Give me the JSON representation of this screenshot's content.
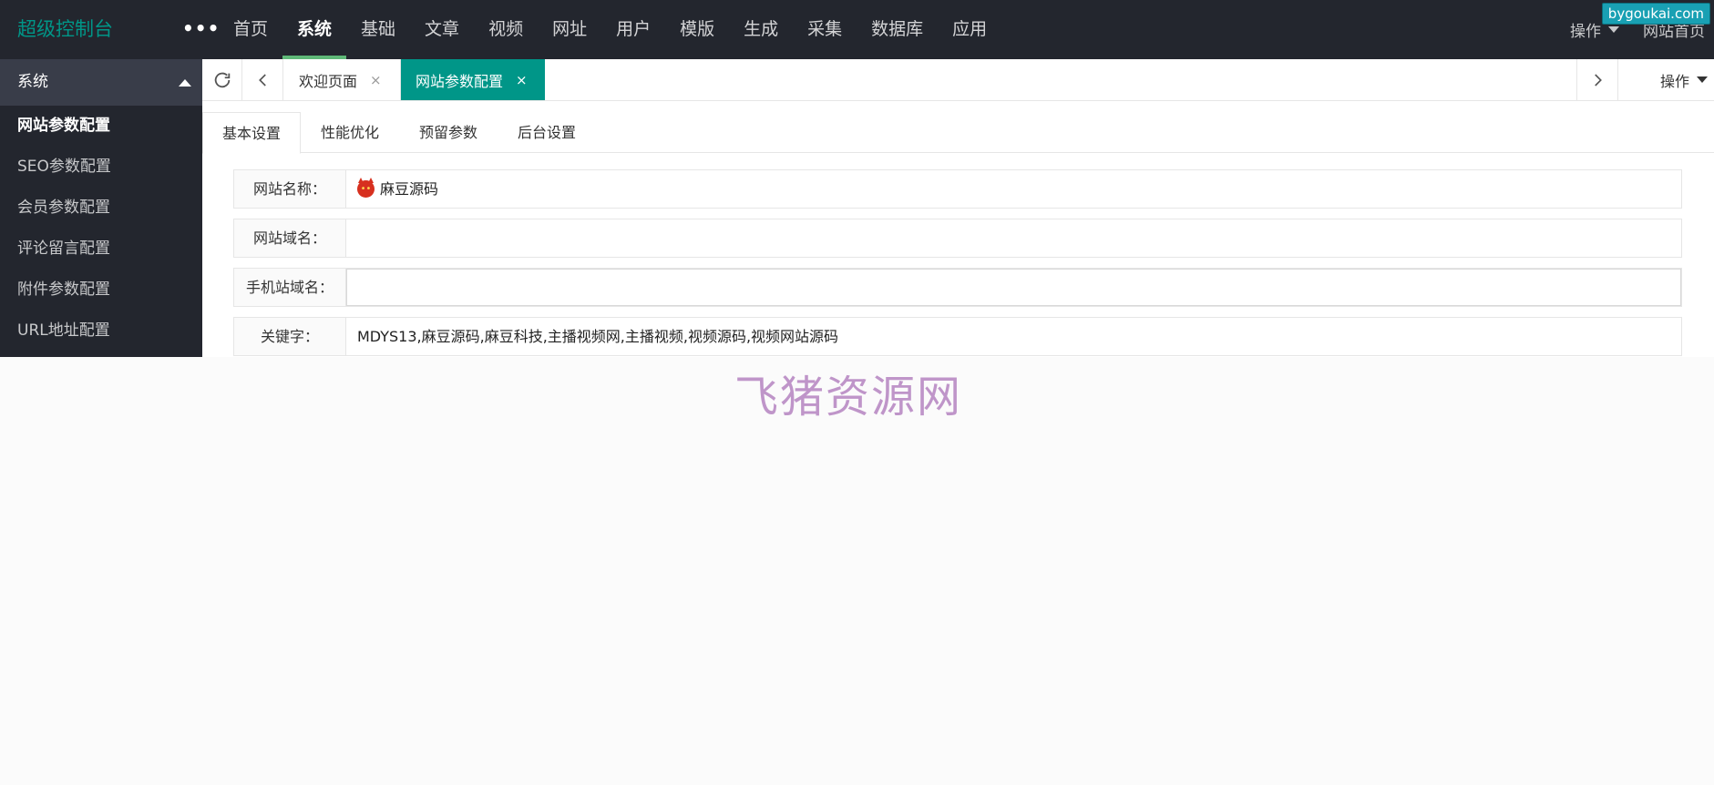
{
  "header": {
    "logo": "超级控制台",
    "more": "•••",
    "nav": [
      "首页",
      "系统",
      "基础",
      "文章",
      "视频",
      "网址",
      "用户",
      "模版",
      "生成",
      "采集",
      "数据库",
      "应用"
    ],
    "ops_label": "操作",
    "site_home": "网站首页",
    "badge": "bygoukai.com",
    "accent": "#009688",
    "active_underline": "#5fb878"
  },
  "sidebar": {
    "section": "系统",
    "items": [
      "网站参数配置",
      "SEO参数配置",
      "会员参数配置",
      "评论留言配置",
      "附件参数配置",
      "URL地址配置"
    ]
  },
  "tabbar": {
    "tabs": [
      {
        "label": "欢迎页面",
        "close": "×"
      },
      {
        "label": "网站参数配置",
        "close": "×"
      }
    ],
    "ops_label": "操作"
  },
  "subtabs": [
    "基本设置",
    "性能优化",
    "预留参数",
    "后台设置"
  ],
  "form": {
    "rows": [
      {
        "label": "网站名称：",
        "value": "麻豆源码"
      },
      {
        "label": "网站域名：",
        "value": ""
      },
      {
        "label": "手机站域名：",
        "value": ""
      },
      {
        "label": "关键字：",
        "value": "MDYS13,麻豆源码,麻豆科技,主播视频网,主播视频,视频源码,视频网站源码"
      }
    ]
  },
  "watermark": "飞猪资源网"
}
